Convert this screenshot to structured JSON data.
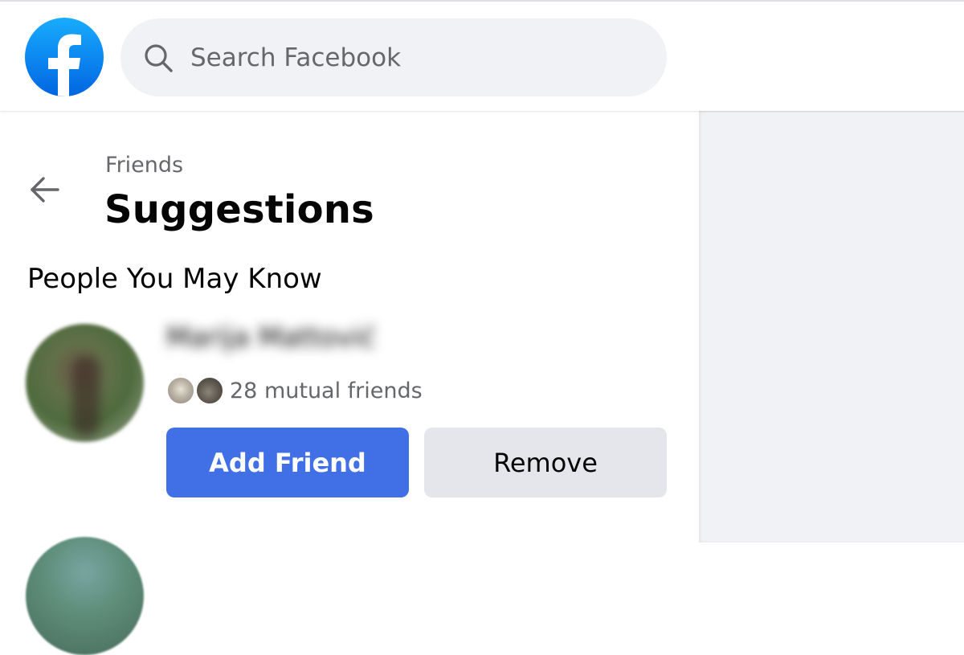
{
  "header": {
    "logo_icon": "facebook-logo-icon",
    "search": {
      "icon": "search-icon",
      "placeholder": "Search Facebook",
      "value": ""
    }
  },
  "left_panel": {
    "back_icon": "arrow-left-icon",
    "breadcrumb": "Friends",
    "title": "Suggestions",
    "section_heading": "People You May Know",
    "suggestions": [
      {
        "name": "Marija Mattović",
        "mutual_friends": "28 mutual friends",
        "add_label": "Add Friend",
        "remove_label": "Remove"
      }
    ]
  },
  "colors": {
    "brand_blue": "#1877f2",
    "primary_button": "#4170e6",
    "secondary_button": "#e4e6eb",
    "search_bg": "#f0f2f5",
    "secondary_text": "#65676b"
  }
}
